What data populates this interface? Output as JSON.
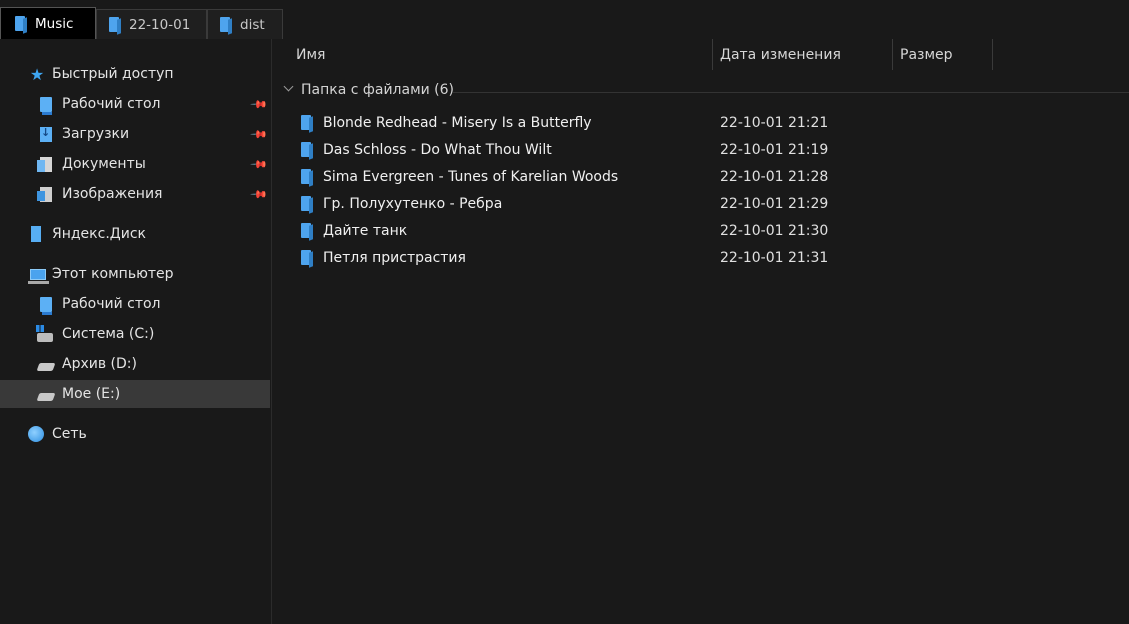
{
  "tabs": [
    {
      "label": "Music",
      "active": true
    },
    {
      "label": "22-10-01",
      "active": false
    },
    {
      "label": "dist",
      "active": false
    }
  ],
  "sidebar": {
    "items": [
      {
        "label": "Быстрый доступ",
        "icon": "star-icon",
        "pinned": false
      },
      {
        "label": "Рабочий стол",
        "icon": "desktop-folder-icon",
        "pinned": true
      },
      {
        "label": "Загрузки",
        "icon": "downloads-folder-icon",
        "pinned": true
      },
      {
        "label": "Документы",
        "icon": "documents-folder-icon",
        "pinned": true
      },
      {
        "label": "Изображения",
        "icon": "pictures-folder-icon",
        "pinned": true
      },
      {
        "label": "Яндекс.Диск",
        "icon": "yandex-disk-icon",
        "pinned": false
      },
      {
        "label": "Этот компьютер",
        "icon": "computer-icon",
        "pinned": false
      },
      {
        "label": "Рабочий стол",
        "icon": "desktop-folder-icon",
        "pinned": false
      },
      {
        "label": "Система (C:)",
        "icon": "system-drive-icon",
        "pinned": false
      },
      {
        "label": "Архив (D:)",
        "icon": "drive-icon",
        "pinned": false
      },
      {
        "label": "Мое (E:)",
        "icon": "drive-icon",
        "pinned": false,
        "selected": true
      },
      {
        "label": "Сеть",
        "icon": "network-icon",
        "pinned": false
      }
    ]
  },
  "columns": {
    "name": "Имя",
    "date": "Дата изменения",
    "size": "Размер"
  },
  "group": {
    "label": "Папка с файлами (6)"
  },
  "files": [
    {
      "name": "Blonde Redhead - Misery Is a Butterfly",
      "date": "22-10-01 21:21"
    },
    {
      "name": "Das Schloss - Do What Thou Wilt",
      "date": "22-10-01 21:19"
    },
    {
      "name": "Sima Evergreen - Tunes of Karelian Woods",
      "date": "22-10-01 21:28"
    },
    {
      "name": "Гр. Полухутенко - Ребра",
      "date": "22-10-01 21:29"
    },
    {
      "name": "Дайте танк",
      "date": "22-10-01 21:30"
    },
    {
      "name": "Петля пристрастия",
      "date": "22-10-01 21:31"
    }
  ],
  "colors": {
    "background": "#191919",
    "selection": "#393939",
    "folder_accent": "#4ea4ee"
  }
}
